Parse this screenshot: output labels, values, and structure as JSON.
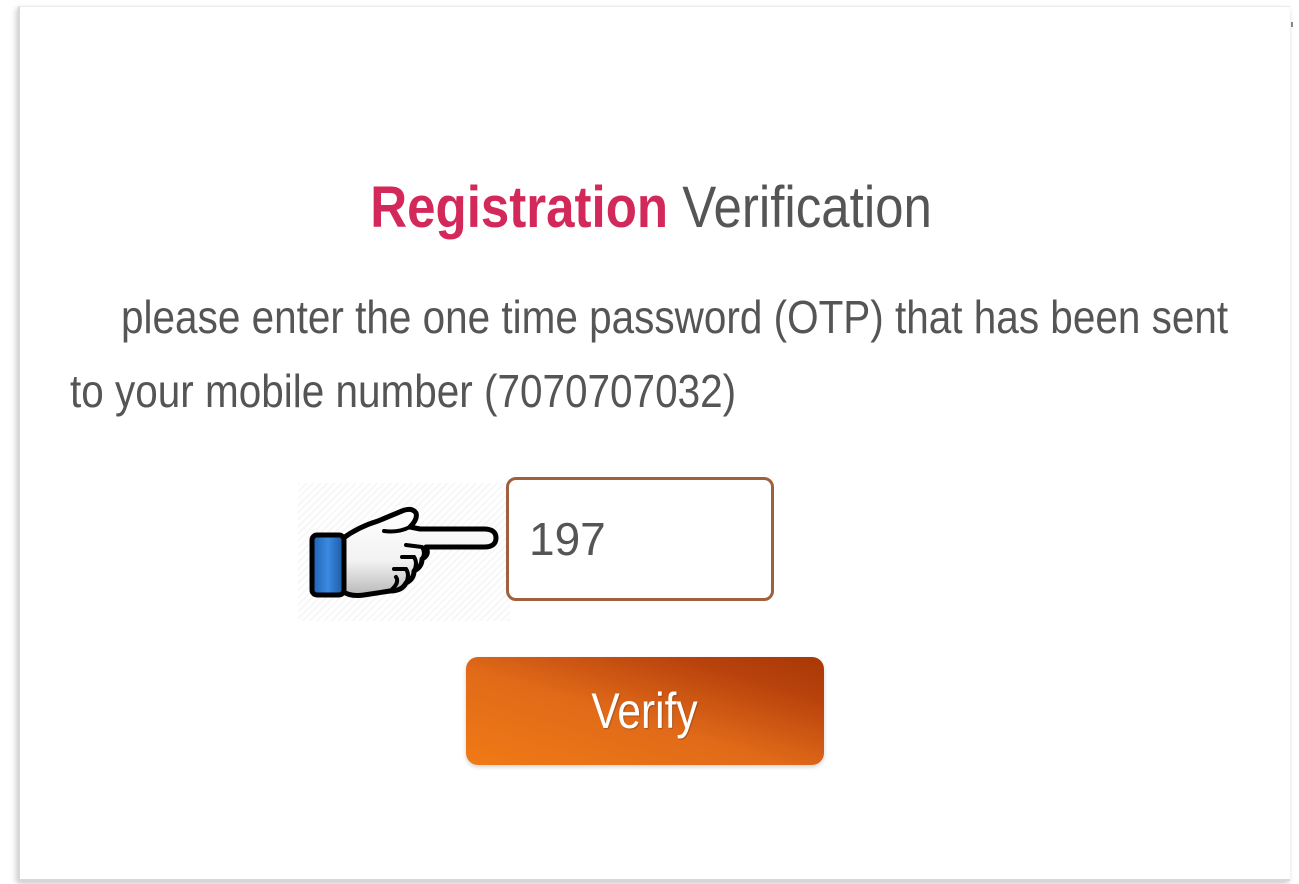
{
  "title": {
    "accent": "Registration",
    "rest": "Verification"
  },
  "description": {
    "line1": "please enter the one time password (OTP) that has been sent",
    "line2": "to your mobile number (7070707032)"
  },
  "otp_input": {
    "value": "197"
  },
  "verify_button": {
    "label": "Verify"
  },
  "pointer_icon": "pointing-hand-icon",
  "colors": {
    "accent": "#d3295a",
    "text": "#555555",
    "button": "#e06a18",
    "input_border": "#a0603e"
  }
}
